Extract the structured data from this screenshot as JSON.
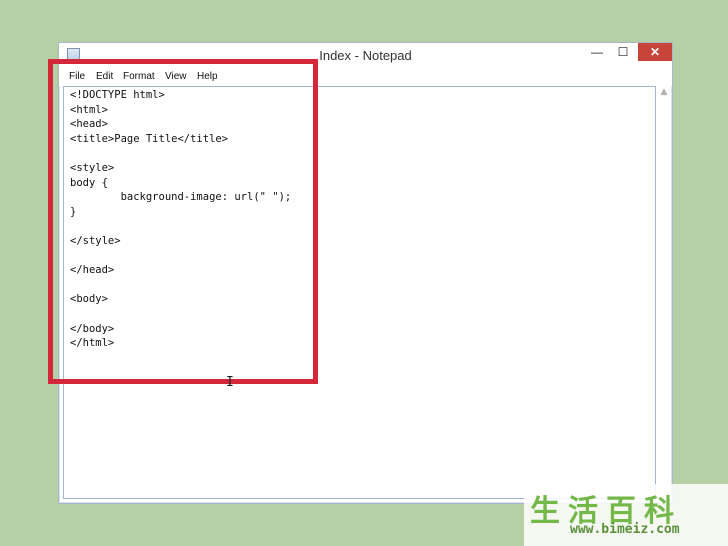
{
  "window": {
    "title": "Index - Notepad",
    "controls": {
      "minimize": "—",
      "maximize": "☐",
      "close": "✕"
    }
  },
  "menu": {
    "items": [
      "File",
      "Edit",
      "Format",
      "View",
      "Help"
    ]
  },
  "editor": {
    "content": "<!DOCTYPE html>\n<html>\n<head>\n<title>Page Title</title>\n\n<style>\nbody {\n        background-image: url(\" \");\n}\n\n</style>\n\n</head>\n\n<body>\n\n</body>\n</html>"
  },
  "icons": {
    "app": "notepad-icon",
    "cursor": "text-cursor-icon",
    "scroll_up": "scroll-up-arrow-icon"
  },
  "highlight": {
    "color": "#d4283a"
  },
  "watermark": {
    "glyphs": "生活百科",
    "url": "www.bimeiz.com"
  }
}
